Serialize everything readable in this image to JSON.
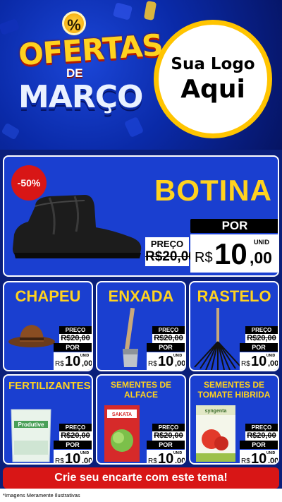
{
  "header": {
    "badge": "%",
    "title_line1": "OFERTAS",
    "title_line2": "DE",
    "title_line3": "MARÇO",
    "logo_line1": "Sua Logo",
    "logo_line2": "Aqui"
  },
  "main_product": {
    "discount": "-50%",
    "name": "BOTINA",
    "old_label": "PREÇO",
    "old_price": "R$20,00",
    "new_label": "POR",
    "currency": "R$",
    "price_int": "10",
    "price_cents": ",00",
    "unit": "UNID"
  },
  "products": [
    {
      "name": "CHAPEU",
      "old_label": "PREÇO",
      "old_price": "R$20,00",
      "new_label": "POR",
      "currency": "R$",
      "price_int": "10",
      "price_cents": ",00",
      "unit": "UNID"
    },
    {
      "name": "ENXADA",
      "old_label": "PREÇO",
      "old_price": "R$20,00",
      "new_label": "POR",
      "currency": "R$",
      "price_int": "10",
      "price_cents": ",00",
      "unit": "UNID"
    },
    {
      "name": "RASTELO",
      "old_label": "PREÇO",
      "old_price": "R$20,00",
      "new_label": "POR",
      "currency": "R$",
      "price_int": "10",
      "price_cents": ",00",
      "unit": "UNID"
    },
    {
      "name": "FERTILIZANTES",
      "product_label": "Produtive",
      "old_label": "PREÇO",
      "old_price": "R$20,00",
      "new_label": "POR",
      "currency": "R$",
      "price_int": "10",
      "price_cents": ",00",
      "unit": "UNID"
    },
    {
      "name": "SEMENTES DE ALFACE",
      "product_label": "SAKATA",
      "old_label": "PREÇO",
      "old_price": "R$20,00",
      "new_label": "POR",
      "currency": "R$",
      "price_int": "10",
      "price_cents": ",00",
      "unit": "UNID"
    },
    {
      "name": "SEMENTES DE TOMATE HIBRIDA",
      "product_label": "syngenta",
      "old_label": "PREÇO",
      "old_price": "R$20,00",
      "new_label": "POR",
      "currency": "R$",
      "price_int": "10",
      "price_cents": ",00",
      "unit": "UNID"
    }
  ],
  "cta": "Crie seu encarte com este tema!",
  "footnote": "*Imagens Meramente Ilustrativas",
  "colors": {
    "accent_yellow": "#ffd21f",
    "card_blue": "#1a3fd0",
    "red": "#d81616"
  }
}
